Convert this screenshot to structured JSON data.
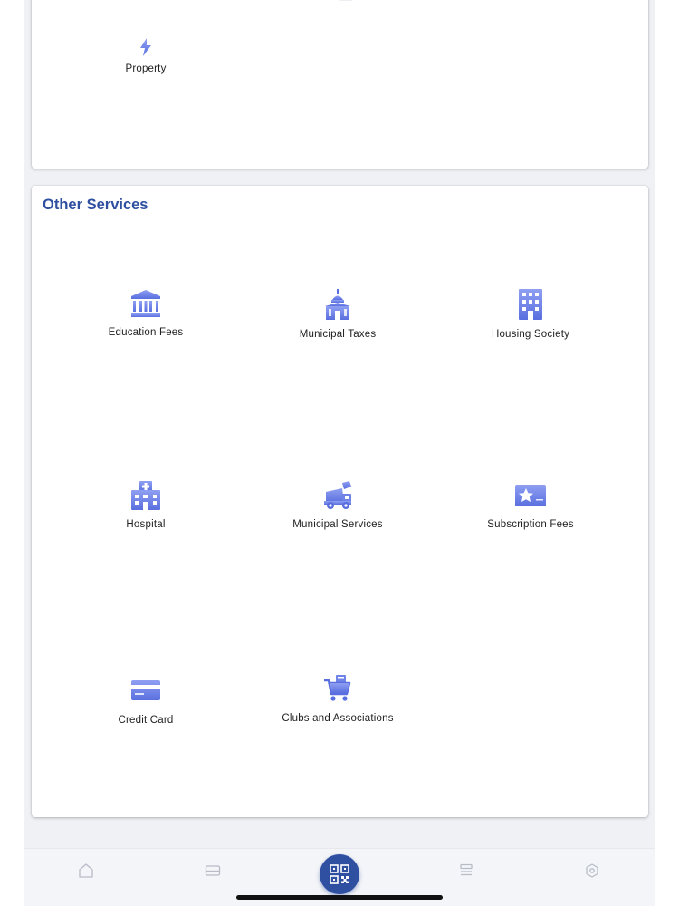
{
  "top_card": {
    "items": [
      {
        "label": "Property",
        "icon": "lightning-icon"
      }
    ]
  },
  "other_services": {
    "title": "Other Services",
    "items": [
      {
        "label": "Education Fees",
        "icon": "institution-icon"
      },
      {
        "label": "Municipal Taxes",
        "icon": "municipal-building-icon"
      },
      {
        "label": "Housing Society",
        "icon": "apartment-building-icon"
      },
      {
        "label": "Hospital",
        "icon": "hospital-icon"
      },
      {
        "label": "Municipal Services",
        "icon": "garbage-truck-icon"
      },
      {
        "label": "Subscription Fees",
        "icon": "star-card-icon"
      },
      {
        "label": "Credit Card",
        "icon": "credit-card-icon"
      },
      {
        "label": "Clubs and Associations",
        "icon": "shopping-cart-icon"
      }
    ]
  },
  "tabbar": {
    "tabs": [
      {
        "icon": "home-icon"
      },
      {
        "icon": "card-icon"
      },
      {
        "icon": "qr-code-icon"
      },
      {
        "icon": "list-icon"
      },
      {
        "icon": "settings-icon"
      }
    ]
  },
  "colors": {
    "accent": "#2f4fa0",
    "icon_light": "#8a9af0",
    "icon_dark": "#5a6fdf",
    "background": "#eff1f5"
  }
}
